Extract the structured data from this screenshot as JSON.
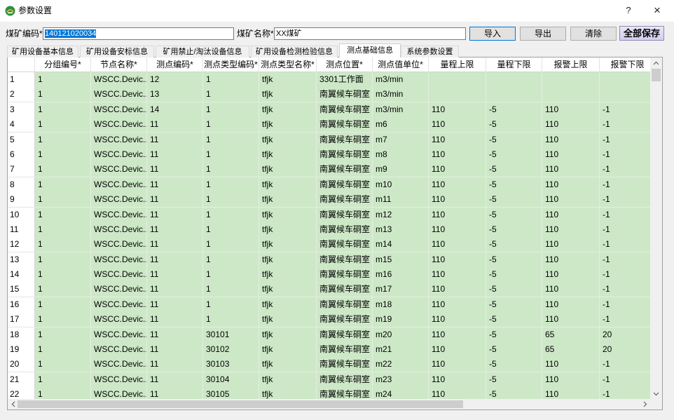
{
  "window": {
    "title": "参数设置",
    "help_label": "?",
    "close_label": "×"
  },
  "toolbar": {
    "coal_code_label": "煤矿编码*",
    "coal_code_value": "140121020034",
    "coal_name_label": "煤矿名称*",
    "coal_name_value": "XX煤矿",
    "import_label": "导入",
    "export_label": "导出",
    "clear_label": "清除",
    "save_all_label": "全部保存"
  },
  "tabs": [
    {
      "label": "矿用设备基本信息"
    },
    {
      "label": "矿用设备安标信息"
    },
    {
      "label": "矿用禁止/淘汰设备信息"
    },
    {
      "label": "矿用设备检测检验信息"
    },
    {
      "label": "测点基础信息"
    },
    {
      "label": "系统参数设置"
    }
  ],
  "active_tab": 4,
  "grid": {
    "columns": [
      "分组编号*",
      "节点名称*",
      "测点编码*",
      "测点类型编码*",
      "测点类型名称*",
      "测点位置*",
      "测点值单位*",
      "量程上限",
      "量程下限",
      "报警上限",
      "报警下限"
    ],
    "rows": [
      {
        "num": "1",
        "cells": [
          "1",
          "WSCC.Devic...",
          "12",
          "1",
          "tfjk",
          "3301工作面",
          "m3/min",
          "",
          "",
          "",
          ""
        ]
      },
      {
        "num": "2",
        "cells": [
          "1",
          "WSCC.Devic...",
          "13",
          "1",
          "tfjk",
          "南翼候车硐室",
          "m3/min",
          "",
          "",
          "",
          ""
        ]
      },
      {
        "num": "3",
        "cells": [
          "1",
          "WSCC.Devic...",
          "14",
          "1",
          "tfjk",
          "南翼候车硐室",
          "m3/min",
          "110",
          "-5",
          "110",
          "-1"
        ]
      },
      {
        "num": "4",
        "cells": [
          "1",
          "WSCC.Devic...",
          "11",
          "1",
          "tfjk",
          "南翼候车硐室",
          "m6",
          "110",
          "-5",
          "110",
          "-1"
        ]
      },
      {
        "num": "5",
        "cells": [
          "1",
          "WSCC.Devic...",
          "11",
          "1",
          "tfjk",
          "南翼候车硐室",
          "m7",
          "110",
          "-5",
          "110",
          "-1"
        ]
      },
      {
        "num": "6",
        "cells": [
          "1",
          "WSCC.Devic...",
          "11",
          "1",
          "tfjk",
          "南翼候车硐室",
          "m8",
          "110",
          "-5",
          "110",
          "-1"
        ]
      },
      {
        "num": "7",
        "cells": [
          "1",
          "WSCC.Devic...",
          "11",
          "1",
          "tfjk",
          "南翼候车硐室",
          "m9",
          "110",
          "-5",
          "110",
          "-1"
        ]
      },
      {
        "num": "8",
        "cells": [
          "1",
          "WSCC.Devic...",
          "11",
          "1",
          "tfjk",
          "南翼候车硐室",
          "m10",
          "110",
          "-5",
          "110",
          "-1"
        ]
      },
      {
        "num": "9",
        "cells": [
          "1",
          "WSCC.Devic...",
          "11",
          "1",
          "tfjk",
          "南翼候车硐室",
          "m11",
          "110",
          "-5",
          "110",
          "-1"
        ]
      },
      {
        "num": "10",
        "cells": [
          "1",
          "WSCC.Devic...",
          "11",
          "1",
          "tfjk",
          "南翼候车硐室",
          "m12",
          "110",
          "-5",
          "110",
          "-1"
        ]
      },
      {
        "num": "11",
        "cells": [
          "1",
          "WSCC.Devic...",
          "11",
          "1",
          "tfjk",
          "南翼候车硐室",
          "m13",
          "110",
          "-5",
          "110",
          "-1"
        ]
      },
      {
        "num": "12",
        "cells": [
          "1",
          "WSCC.Devic...",
          "11",
          "1",
          "tfjk",
          "南翼候车硐室",
          "m14",
          "110",
          "-5",
          "110",
          "-1"
        ]
      },
      {
        "num": "13",
        "cells": [
          "1",
          "WSCC.Devic...",
          "11",
          "1",
          "tfjk",
          "南翼候车硐室",
          "m15",
          "110",
          "-5",
          "110",
          "-1"
        ]
      },
      {
        "num": "14",
        "cells": [
          "1",
          "WSCC.Devic...",
          "11",
          "1",
          "tfjk",
          "南翼候车硐室",
          "m16",
          "110",
          "-5",
          "110",
          "-1"
        ]
      },
      {
        "num": "15",
        "cells": [
          "1",
          "WSCC.Devic...",
          "11",
          "1",
          "tfjk",
          "南翼候车硐室",
          "m17",
          "110",
          "-5",
          "110",
          "-1"
        ]
      },
      {
        "num": "16",
        "cells": [
          "1",
          "WSCC.Devic...",
          "11",
          "1",
          "tfjk",
          "南翼候车硐室",
          "m18",
          "110",
          "-5",
          "110",
          "-1"
        ]
      },
      {
        "num": "17",
        "cells": [
          "1",
          "WSCC.Devic...",
          "11",
          "1",
          "tfjk",
          "南翼候车硐室",
          "m19",
          "110",
          "-5",
          "110",
          "-1"
        ]
      },
      {
        "num": "18",
        "cells": [
          "1",
          "WSCC.Devic...",
          "11",
          "30101",
          "tfjk",
          "南翼候车硐室",
          "m20",
          "110",
          "-5",
          "65",
          "20"
        ]
      },
      {
        "num": "19",
        "cells": [
          "1",
          "WSCC.Devic...",
          "11",
          "30102",
          "tfjk",
          "南翼候车硐室",
          "m21",
          "110",
          "-5",
          "65",
          "20"
        ]
      },
      {
        "num": "20",
        "cells": [
          "1",
          "WSCC.Devic...",
          "11",
          "30103",
          "tfjk",
          "南翼候车硐室",
          "m22",
          "110",
          "-5",
          "110",
          "-1"
        ]
      },
      {
        "num": "21",
        "cells": [
          "1",
          "WSCC.Devic...",
          "11",
          "30104",
          "tfjk",
          "南翼候车硐室",
          "m23",
          "110",
          "-5",
          "110",
          "-1"
        ]
      },
      {
        "num": "22",
        "cells": [
          "1",
          "WSCC.Devic...",
          "11",
          "30105",
          "tfjk",
          "南翼候车硐室",
          "m24",
          "110",
          "-5",
          "110",
          "-1"
        ]
      }
    ]
  },
  "icons": {
    "app": "app-logo-icon",
    "scroll_up": "chevron-up-icon",
    "scroll_down": "chevron-down-icon",
    "scroll_left": "chevron-left-icon",
    "scroll_right": "chevron-right-icon"
  },
  "colors": {
    "cell_bg": "#cde8c7",
    "selection_bg": "#0078d7",
    "accent": "#0078d7",
    "save_bg": "#d4cdee"
  }
}
